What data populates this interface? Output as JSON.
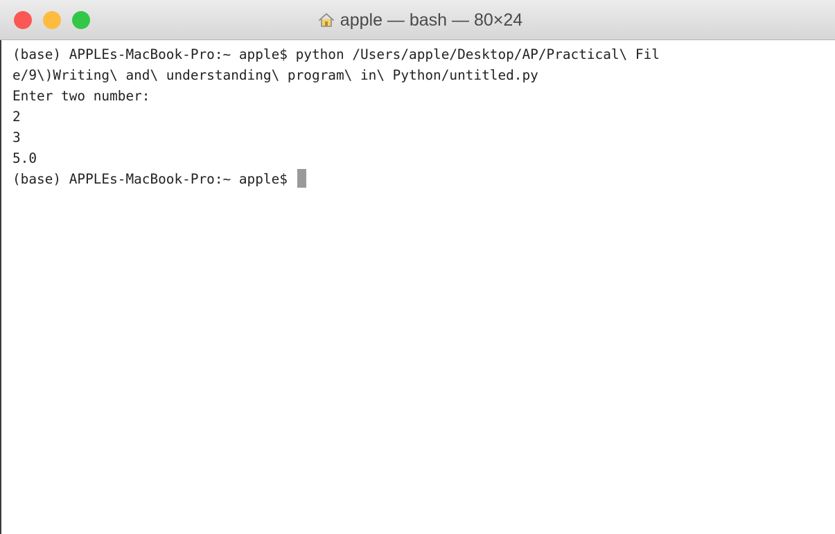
{
  "window": {
    "title": "apple — bash — 80×24",
    "title_icon": "home-icon",
    "controls": {
      "close_color": "#fc5753",
      "minimize_color": "#fdbc40",
      "zoom_color": "#33c748"
    }
  },
  "terminal": {
    "lines": [
      "(base) APPLEs-MacBook-Pro:~ apple$ python /Users/apple/Desktop/AP/Practical\\ Fil",
      "e/9\\)Writing\\ and\\ understanding\\ program\\ in\\ Python/untitled.py",
      "Enter two number:",
      "2",
      "3",
      "5.0"
    ],
    "prompt": "(base) APPLEs-MacBook-Pro:~ apple$ ",
    "cursor_color": "#9a9a9a"
  }
}
